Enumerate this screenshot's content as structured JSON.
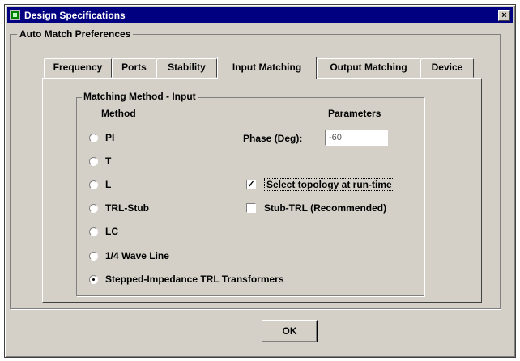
{
  "window": {
    "title": "Design Specifications",
    "close_label": "×"
  },
  "outer_group": {
    "label": "Auto Match Preferences"
  },
  "tabs": [
    {
      "label": "Frequency",
      "active": false
    },
    {
      "label": "Ports",
      "active": false
    },
    {
      "label": "Stability",
      "active": false
    },
    {
      "label": "Input Matching",
      "active": true
    },
    {
      "label": "Output Matching",
      "active": false
    },
    {
      "label": "Device",
      "active": false
    }
  ],
  "matching_group": {
    "label": "Matching Method - Input",
    "method_header": "Method",
    "params_header": "Parameters",
    "methods": [
      {
        "label": "PI",
        "selected": false
      },
      {
        "label": "T",
        "selected": false
      },
      {
        "label": "L",
        "selected": false
      },
      {
        "label": "TRL-Stub",
        "selected": false
      },
      {
        "label": "LC",
        "selected": false
      },
      {
        "label": "1/4 Wave Line",
        "selected": false
      },
      {
        "label": "Stepped-Impedance TRL Transformers",
        "selected": true
      }
    ],
    "phase": {
      "label": "Phase (Deg):",
      "value": "-60"
    },
    "select_topology": {
      "label": "Select topology at run-time",
      "checked": true
    },
    "stub_trl": {
      "label": "Stub-TRL (Recommended)",
      "checked": false
    }
  },
  "ok_label": "OK"
}
